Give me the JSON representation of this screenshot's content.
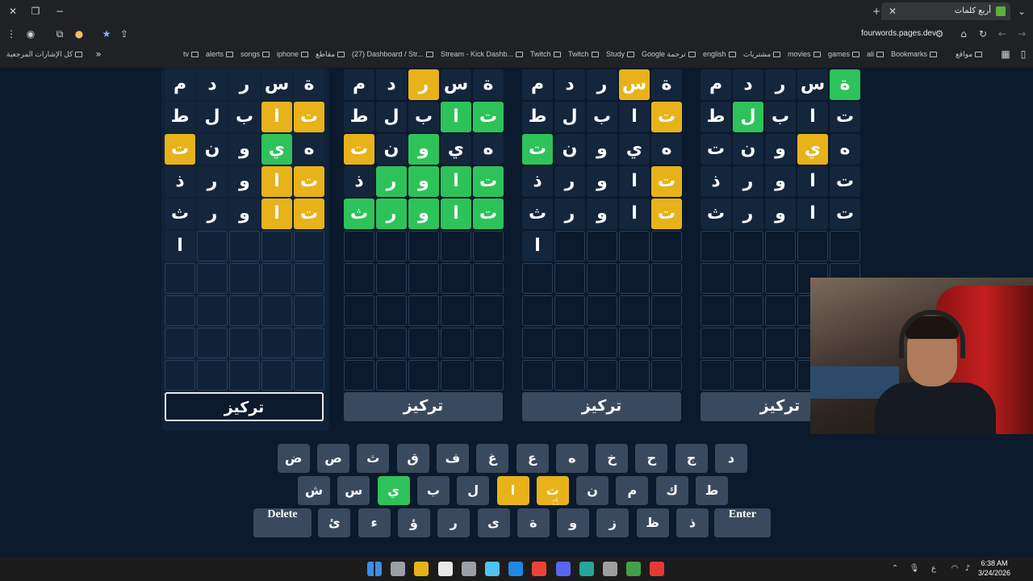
{
  "browser": {
    "tab_title": "أربع كلمات",
    "url": "fourwords.pages.dev",
    "bookmarks": [
      "Bookmarks",
      "ali",
      "games",
      "movies",
      "مشتريات",
      "english",
      "Google ترجمة",
      "Study",
      "Twitch",
      "Twitch",
      "Stream - Kick Dashb...",
      "(27) Dashboard / Str...",
      "مقاطع",
      "iphone",
      "songs",
      "alerts",
      "tv"
    ],
    "bookmarks_left": "كل الإشارات المرجعية",
    "sites_label": "مواقع"
  },
  "boards": [
    {
      "rows": [
        [
          "م",
          "د",
          "ر",
          "س",
          "ة"
        ],
        [
          "ط",
          "ل",
          "ب",
          "ا",
          "ت"
        ],
        [
          "ت",
          "ن",
          "و",
          "ي",
          "ه"
        ],
        [
          "ذ",
          "ر",
          "و",
          "ا",
          "ت"
        ],
        [
          "ث",
          "ر",
          "و",
          "ا",
          "ت"
        ],
        [
          "ا",
          "",
          "",
          "",
          ""
        ]
      ],
      "states": [
        [
          "f",
          "f",
          "f",
          "f",
          "f"
        ],
        [
          "f",
          "f",
          "f",
          "y",
          "y"
        ],
        [
          "y",
          "f",
          "f",
          "g",
          "f"
        ],
        [
          "f",
          "f",
          "f",
          "y",
          "y"
        ],
        [
          "f",
          "f",
          "f",
          "y",
          "y"
        ],
        [
          "f",
          "e",
          "e",
          "e",
          "e"
        ]
      ],
      "focus_label": "تركيز",
      "active": true
    },
    {
      "rows": [
        [
          "م",
          "د",
          "ر",
          "س",
          "ة"
        ],
        [
          "ط",
          "ل",
          "ب",
          "ا",
          "ت"
        ],
        [
          "ت",
          "ن",
          "و",
          "ي",
          "ه"
        ],
        [
          "ذ",
          "ر",
          "و",
          "ا",
          "ت"
        ],
        [
          "ث",
          "ر",
          "و",
          "ا",
          "ت"
        ],
        [
          "",
          "",
          "",
          "",
          ""
        ]
      ],
      "states": [
        [
          "f",
          "f",
          "y",
          "f",
          "f"
        ],
        [
          "f",
          "f",
          "f",
          "g",
          "g"
        ],
        [
          "y",
          "f",
          "g",
          "f",
          "f"
        ],
        [
          "f",
          "g",
          "g",
          "g",
          "g"
        ],
        [
          "g",
          "g",
          "g",
          "g",
          "g"
        ],
        [
          "e",
          "e",
          "e",
          "e",
          "e"
        ]
      ],
      "focus_label": "تركيز",
      "active": false
    },
    {
      "rows": [
        [
          "م",
          "د",
          "ر",
          "س",
          "ة"
        ],
        [
          "ط",
          "ل",
          "ب",
          "ا",
          "ت"
        ],
        [
          "ت",
          "ن",
          "و",
          "ي",
          "ه"
        ],
        [
          "ذ",
          "ر",
          "و",
          "ا",
          "ت"
        ],
        [
          "ث",
          "ر",
          "و",
          "ا",
          "ت"
        ],
        [
          "ا",
          "",
          "",
          "",
          ""
        ]
      ],
      "states": [
        [
          "f",
          "f",
          "f",
          "y",
          "f"
        ],
        [
          "f",
          "f",
          "f",
          "f",
          "y"
        ],
        [
          "g",
          "f",
          "f",
          "f",
          "f"
        ],
        [
          "f",
          "f",
          "f",
          "f",
          "y"
        ],
        [
          "f",
          "f",
          "f",
          "f",
          "y"
        ],
        [
          "f",
          "e",
          "e",
          "e",
          "e"
        ]
      ],
      "focus_label": "تركيز",
      "active": false
    },
    {
      "rows": [
        [
          "م",
          "د",
          "ر",
          "س",
          "ة"
        ],
        [
          "ط",
          "ل",
          "ب",
          "ا",
          "ت"
        ],
        [
          "ت",
          "ن",
          "و",
          "ي",
          "ه"
        ],
        [
          "ذ",
          "ر",
          "و",
          "ا",
          "ت"
        ],
        [
          "ث",
          "ر",
          "و",
          "ا",
          "ت"
        ],
        [
          "",
          "",
          "",
          "",
          ""
        ]
      ],
      "states": [
        [
          "f",
          "f",
          "f",
          "f",
          "g"
        ],
        [
          "f",
          "g",
          "f",
          "f",
          "f"
        ],
        [
          "f",
          "f",
          "f",
          "y",
          "f"
        ],
        [
          "f",
          "f",
          "f",
          "f",
          "f"
        ],
        [
          "f",
          "f",
          "f",
          "f",
          "f"
        ],
        [
          "e",
          "e",
          "e",
          "e",
          "e"
        ]
      ],
      "focus_label": "تركيز",
      "active": false
    }
  ],
  "keyboard": {
    "row1": [
      "د",
      "ج",
      "ح",
      "خ",
      "ه",
      "ع",
      "غ",
      "ف",
      "ق",
      "ث",
      "ص",
      "ض"
    ],
    "row2": [
      "ط",
      "ك",
      "م",
      "ن",
      "ت",
      "ا",
      "ل",
      "ب",
      "ي",
      "س",
      "ش"
    ],
    "row2_states": [
      "",
      "",
      "",
      "",
      "y",
      "y",
      "",
      "",
      "g",
      "",
      ""
    ],
    "row3": [
      "ذ",
      "ظ",
      "ز",
      "و",
      "ة",
      "ى",
      "ر",
      "ؤ",
      "ء",
      "ئ"
    ],
    "enter": "Enter",
    "delete": "Delete"
  },
  "taskbar": {
    "time": "6:38 AM",
    "date": "3/24/2026",
    "lang": "ع"
  },
  "colors": {
    "green": "#2ec25a",
    "yellow": "#e8b21a",
    "tile": "#13263c",
    "bg": "#0b1a2c",
    "key": "#3a4a5e"
  }
}
